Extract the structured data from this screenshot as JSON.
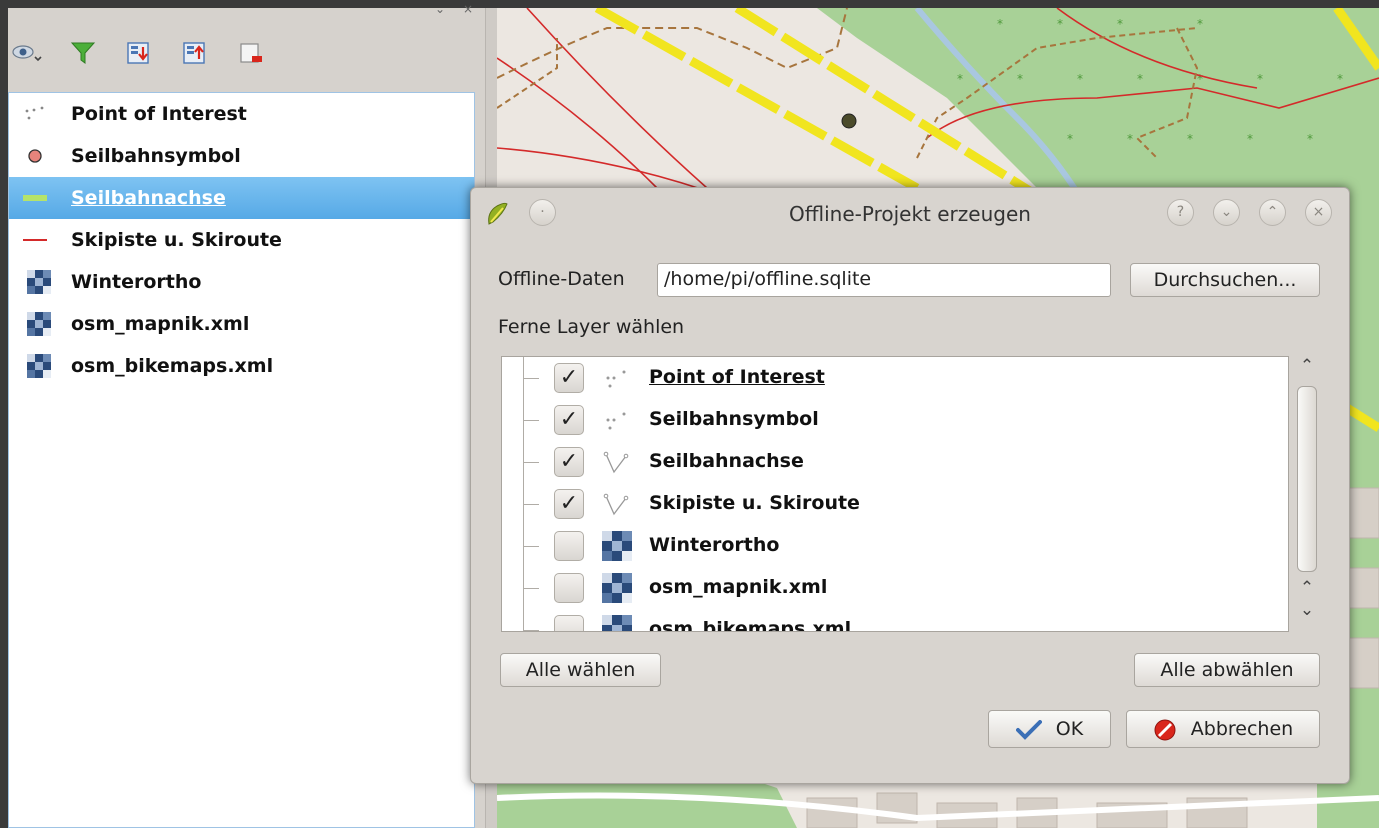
{
  "layer_panel": {
    "layers": [
      {
        "label": "Point of Interest",
        "icon": "point-dots-icon"
      },
      {
        "label": "Seilbahnsymbol",
        "icon": "red-circle-icon"
      },
      {
        "label": "Seilbahnachse",
        "icon": "green-line-icon",
        "selected": true
      },
      {
        "label": "Skipiste u. Skiroute",
        "icon": "red-line-icon"
      },
      {
        "label": "Winterortho",
        "icon": "raster-icon"
      },
      {
        "label": "osm_mapnik.xml",
        "icon": "raster-icon"
      },
      {
        "label": "osm_bikemaps.xml",
        "icon": "raster-icon"
      }
    ]
  },
  "dialog": {
    "title": "Offline-Projekt erzeugen",
    "offline_label": "Offline-Daten",
    "path_value": "/home/pi/offline.sqlite",
    "browse_label": "Durchsuchen...",
    "remote_label": "Ferne Layer wählen",
    "items": [
      {
        "label": "Point of Interest",
        "checked": true,
        "icon": "point-dots-icon"
      },
      {
        "label": "Seilbahnsymbol",
        "checked": true,
        "icon": "point-dots-icon"
      },
      {
        "label": "Seilbahnachse",
        "checked": true,
        "icon": "line-vertex-icon"
      },
      {
        "label": "Skipiste u. Skiroute",
        "checked": true,
        "icon": "line-vertex-icon"
      },
      {
        "label": "Winterortho",
        "checked": false,
        "icon": "raster-icon"
      },
      {
        "label": "osm_mapnik.xml",
        "checked": false,
        "icon": "raster-icon"
      },
      {
        "label": "osm_bikemaps.xml",
        "checked": false,
        "icon": "raster-icon"
      }
    ],
    "select_all_label": "Alle wählen",
    "deselect_all_label": "Alle abwählen",
    "ok_label": "OK",
    "cancel_label": "Abbrechen"
  },
  "colors": {
    "selection": "#56a9e6",
    "map_green": "#a8d197",
    "cable_yellow": "#f1e51f",
    "piste_red": "#d42a2a"
  }
}
